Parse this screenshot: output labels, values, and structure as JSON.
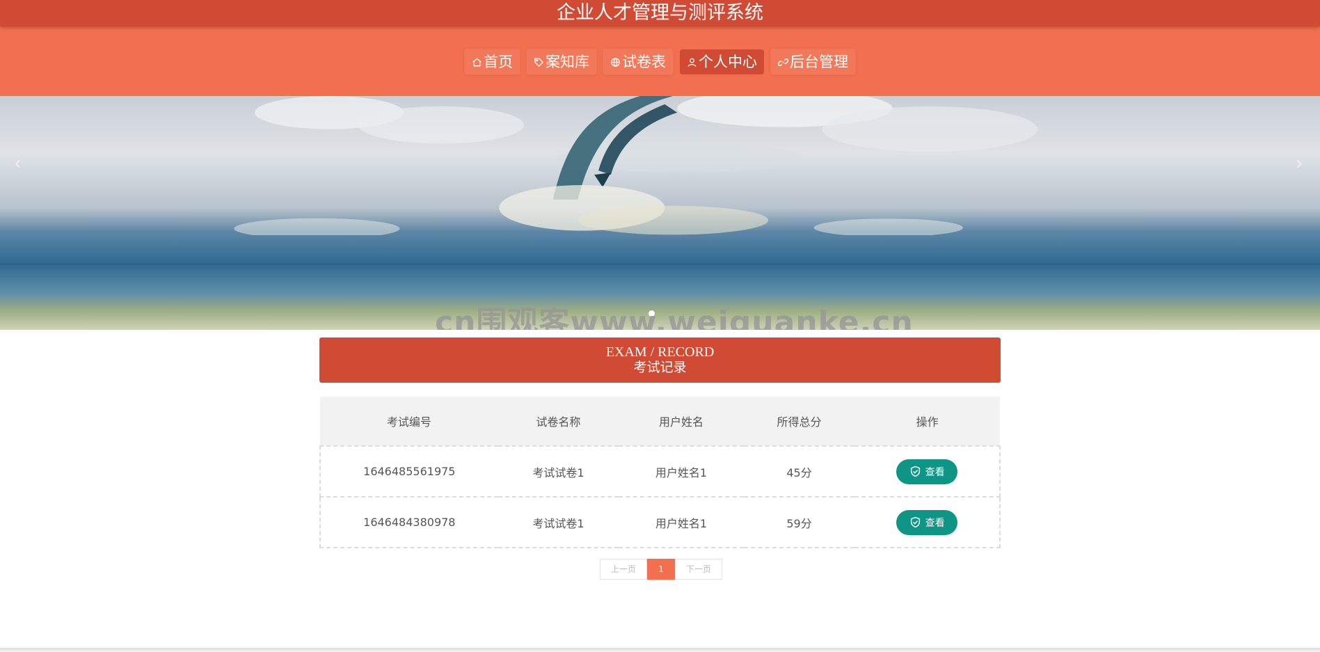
{
  "app": {
    "title": "企业人才管理与测评系统"
  },
  "nav": {
    "items": [
      {
        "label": "首页",
        "icon": "home-icon"
      },
      {
        "label": "案知库",
        "icon": "tag-icon"
      },
      {
        "label": "试卷表",
        "icon": "globe-icon"
      },
      {
        "label": "个人中心",
        "icon": "user-icon",
        "active": true
      },
      {
        "label": "后台管理",
        "icon": "link-icon"
      }
    ]
  },
  "banner": {
    "prev_arrow": "‹",
    "next_arrow": "›",
    "watermark": "cn围观客www.weiguanke.cn"
  },
  "section": {
    "en_title": "EXAM / RECORD",
    "cn_title": "考试记录"
  },
  "table": {
    "headers": [
      "考试编号",
      "试卷名称",
      "用户姓名",
      "所得总分",
      "操作"
    ],
    "rows": [
      {
        "exam_id": "1646485561975",
        "paper": "考试试卷1",
        "user": "用户姓名1",
        "score": "45分",
        "action": "查看"
      },
      {
        "exam_id": "1646484380978",
        "paper": "考试试卷1",
        "user": "用户姓名1",
        "score": "59分",
        "action": "查看"
      }
    ]
  },
  "pager": {
    "prev": "上一页",
    "current": "1",
    "next": "下一页"
  },
  "colors": {
    "title_bar": "#d14a33",
    "nav_bar": "#f2704f",
    "view_button": "#0e9585"
  }
}
